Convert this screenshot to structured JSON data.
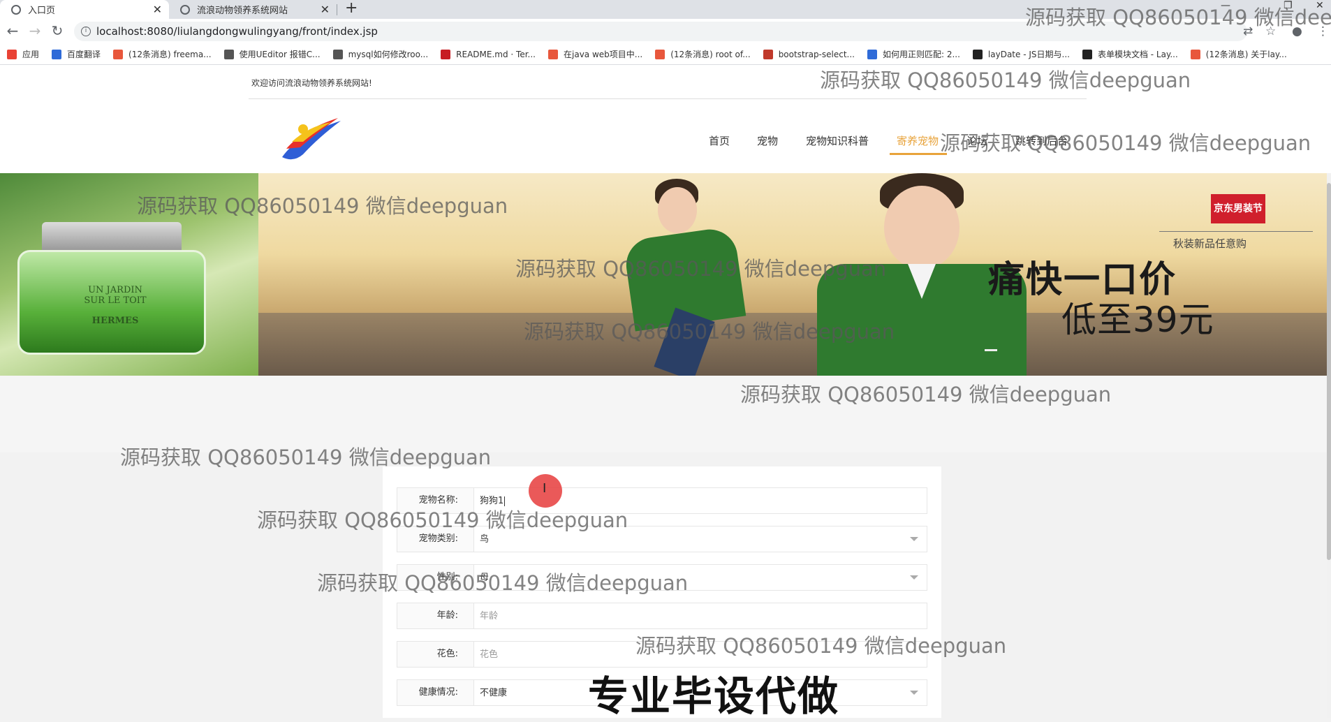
{
  "browser": {
    "tabs": [
      {
        "title": "入口页",
        "active": true
      },
      {
        "title": "流浪动物领养系统网站",
        "active": false
      }
    ],
    "new_tab": "+",
    "url": "localhost:8080/liulangdongwulingyang/front/index.jsp",
    "bookmarks": [
      {
        "label": "应用",
        "icon": "apps-icon",
        "color": "#e94235"
      },
      {
        "label": "百度翻译",
        "icon": "baidu-translate-icon",
        "color": "#2f6bd8"
      },
      {
        "label": "(12条消息) freema...",
        "icon": "csdn-icon",
        "color": "#e8573c"
      },
      {
        "label": "使用UEditor 报错C...",
        "icon": "link-icon",
        "color": "#555"
      },
      {
        "label": "mysql如何修改roo...",
        "icon": "link-icon",
        "color": "#555"
      },
      {
        "label": "README.md · Ter...",
        "icon": "gitee-icon",
        "color": "#c71d23"
      },
      {
        "label": "在java web项目中...",
        "icon": "csdn-icon",
        "color": "#e8573c"
      },
      {
        "label": "(12条消息) root of...",
        "icon": "csdn-icon",
        "color": "#e8573c"
      },
      {
        "label": "bootstrap-select...",
        "icon": "doc-icon",
        "color": "#c0392b"
      },
      {
        "label": "如何用正则匹配: 2...",
        "icon": "baidu-icon",
        "color": "#2f6bd8"
      },
      {
        "label": "layDate - JS日期与...",
        "icon": "layui-icon",
        "color": "#222"
      },
      {
        "label": "表单模块文档 - Lay...",
        "icon": "layui-icon",
        "color": "#222"
      },
      {
        "label": "(12条消息) 关于lay...",
        "icon": "csdn-icon",
        "color": "#e8573c"
      }
    ]
  },
  "site": {
    "welcome": "欢迎访问流浪动物领养系统网站!",
    "nav": [
      {
        "label": "首页",
        "active": false
      },
      {
        "label": "宠物",
        "active": false
      },
      {
        "label": "宠物知识科普",
        "active": false
      },
      {
        "label": "寄养宠物",
        "active": true
      },
      {
        "label": "论坛",
        "active": false
      },
      {
        "label": "跳转到后台",
        "active": false
      }
    ]
  },
  "banner": {
    "left_text_1": "UN JARDIN",
    "left_text_2": "SUR LE TOIT",
    "left_text_3": "HERMES",
    "badge": "京东男装节",
    "subtitle": "秋装新品任意购",
    "title": "痛快一口价",
    "price": "低至39元"
  },
  "form": {
    "fields": [
      {
        "label": "宠物名称:",
        "value": "狗狗1",
        "placeholder": "",
        "type": "text"
      },
      {
        "label": "宠物类别:",
        "value": "鸟",
        "placeholder": "",
        "type": "select"
      },
      {
        "label": "性别:",
        "value": "母",
        "placeholder": "",
        "type": "select"
      },
      {
        "label": "年龄:",
        "value": "",
        "placeholder": "年龄",
        "type": "text"
      },
      {
        "label": "花色:",
        "value": "",
        "placeholder": "花色",
        "type": "text"
      },
      {
        "label": "健康情况:",
        "value": "不健康",
        "placeholder": "",
        "type": "select"
      }
    ]
  },
  "overlay_text": "专业毕设代做",
  "watermark": "源码获取 QQ86050149 微信deepguan",
  "colors": {
    "accent": "#e8a33b",
    "banner_badge": "#d01f2c",
    "sweater": "#2f7a2f",
    "click_marker": "#e63c3c"
  }
}
